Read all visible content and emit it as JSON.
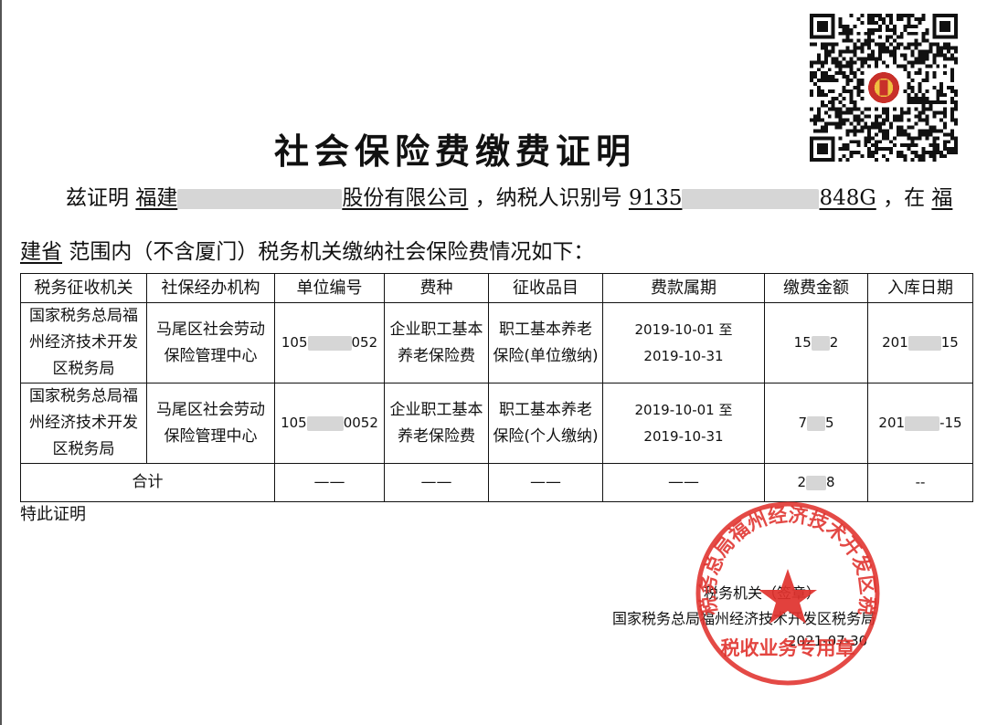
{
  "document": {
    "title": "社会保险费缴费证明",
    "intro_prefix": "兹证明",
    "company_visible_start": "福建",
    "company_visible_end": "股份有限公司",
    "taxpayer_label": "，纳税人识别号",
    "taxpayer_id_start": "9135",
    "taxpayer_id_end": "848G",
    "at_label": "，在",
    "region_start": "福",
    "region_end": "建省",
    "scope_text": "范围内（不含厦门）税务机关缴纳社会保险费情况如下：",
    "closing": "特此证明"
  },
  "table": {
    "headers": [
      "税务征收机关",
      "社保经办机构",
      "单位编号",
      "费种",
      "征收品目",
      "费款属期",
      "缴费金额",
      "入库日期"
    ],
    "rows": [
      {
        "tax_office": "国家税务总局福州经济技术开发区税务局",
        "insurance_agency": "马尾区社会劳动保险管理中心",
        "unit_no_start": "105",
        "unit_no_end": "052",
        "fee_type": "企业职工基本养老保险费",
        "item": "职工基本养老保险(单位缴纳)",
        "period": "2019-10-01 至 2019-10-31",
        "amount_start": "15",
        "amount_end": "2",
        "date_start": "201",
        "date_end": "15"
      },
      {
        "tax_office": "国家税务总局福州经济技术开发区税务局",
        "insurance_agency": "马尾区社会劳动保险管理中心",
        "unit_no_start": "105",
        "unit_no_end": "0052",
        "fee_type": "企业职工基本养老保险费",
        "item": "职工基本养老保险(个人缴纳)",
        "period": "2019-10-01 至 2019-10-31",
        "amount_start": "7",
        "amount_end": "5",
        "date_start": "201",
        "date_end": "-15"
      }
    ],
    "total": {
      "label": "合计",
      "dash_long": "——",
      "amount_start": "2",
      "amount_end": "8",
      "dash_short": "--"
    }
  },
  "signature": {
    "org_label": "税务机关（签章）",
    "bureau": "国家税务总局福州经济技术开发区税务局",
    "date": "2021-07-30"
  },
  "seal": {
    "ring_text": "国家税务总局福州经济技术开发区税务局",
    "bottom_text": "税收业务专用章",
    "color": "#e0312c"
  }
}
